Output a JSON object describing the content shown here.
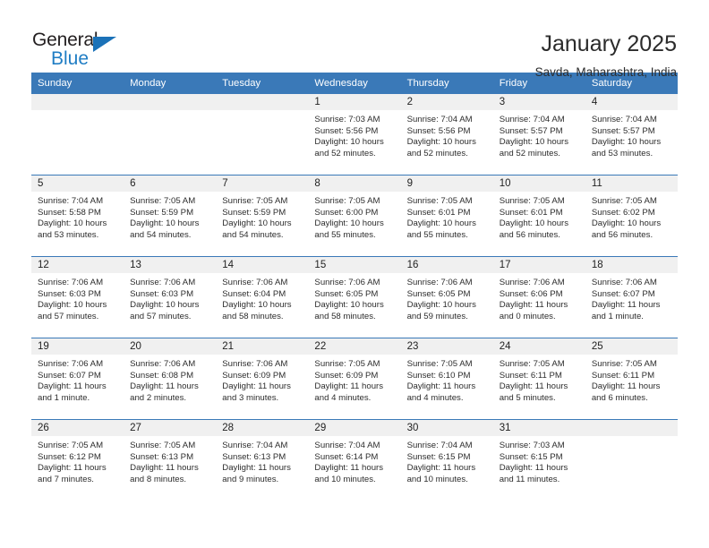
{
  "logo": {
    "word1": "General",
    "word2": "Blue",
    "triangle_color": "#1b72b8",
    "blue_color": "#1f7dc4"
  },
  "header": {
    "title": "January 2025",
    "subtitle": "Savda, Maharashtra, India"
  },
  "calendar": {
    "header_bg": "#3a79b8",
    "daynum_bg": "#f0f0f0",
    "weekdays": [
      "Sunday",
      "Monday",
      "Tuesday",
      "Wednesday",
      "Thursday",
      "Friday",
      "Saturday"
    ],
    "weeks": [
      [
        {
          "day": "",
          "lines": []
        },
        {
          "day": "",
          "lines": []
        },
        {
          "day": "",
          "lines": []
        },
        {
          "day": "1",
          "lines": [
            "Sunrise: 7:03 AM",
            "Sunset: 5:56 PM",
            "Daylight: 10 hours",
            "and 52 minutes."
          ]
        },
        {
          "day": "2",
          "lines": [
            "Sunrise: 7:04 AM",
            "Sunset: 5:56 PM",
            "Daylight: 10 hours",
            "and 52 minutes."
          ]
        },
        {
          "day": "3",
          "lines": [
            "Sunrise: 7:04 AM",
            "Sunset: 5:57 PM",
            "Daylight: 10 hours",
            "and 52 minutes."
          ]
        },
        {
          "day": "4",
          "lines": [
            "Sunrise: 7:04 AM",
            "Sunset: 5:57 PM",
            "Daylight: 10 hours",
            "and 53 minutes."
          ]
        }
      ],
      [
        {
          "day": "5",
          "lines": [
            "Sunrise: 7:04 AM",
            "Sunset: 5:58 PM",
            "Daylight: 10 hours",
            "and 53 minutes."
          ]
        },
        {
          "day": "6",
          "lines": [
            "Sunrise: 7:05 AM",
            "Sunset: 5:59 PM",
            "Daylight: 10 hours",
            "and 54 minutes."
          ]
        },
        {
          "day": "7",
          "lines": [
            "Sunrise: 7:05 AM",
            "Sunset: 5:59 PM",
            "Daylight: 10 hours",
            "and 54 minutes."
          ]
        },
        {
          "day": "8",
          "lines": [
            "Sunrise: 7:05 AM",
            "Sunset: 6:00 PM",
            "Daylight: 10 hours",
            "and 55 minutes."
          ]
        },
        {
          "day": "9",
          "lines": [
            "Sunrise: 7:05 AM",
            "Sunset: 6:01 PM",
            "Daylight: 10 hours",
            "and 55 minutes."
          ]
        },
        {
          "day": "10",
          "lines": [
            "Sunrise: 7:05 AM",
            "Sunset: 6:01 PM",
            "Daylight: 10 hours",
            "and 56 minutes."
          ]
        },
        {
          "day": "11",
          "lines": [
            "Sunrise: 7:05 AM",
            "Sunset: 6:02 PM",
            "Daylight: 10 hours",
            "and 56 minutes."
          ]
        }
      ],
      [
        {
          "day": "12",
          "lines": [
            "Sunrise: 7:06 AM",
            "Sunset: 6:03 PM",
            "Daylight: 10 hours",
            "and 57 minutes."
          ]
        },
        {
          "day": "13",
          "lines": [
            "Sunrise: 7:06 AM",
            "Sunset: 6:03 PM",
            "Daylight: 10 hours",
            "and 57 minutes."
          ]
        },
        {
          "day": "14",
          "lines": [
            "Sunrise: 7:06 AM",
            "Sunset: 6:04 PM",
            "Daylight: 10 hours",
            "and 58 minutes."
          ]
        },
        {
          "day": "15",
          "lines": [
            "Sunrise: 7:06 AM",
            "Sunset: 6:05 PM",
            "Daylight: 10 hours",
            "and 58 minutes."
          ]
        },
        {
          "day": "16",
          "lines": [
            "Sunrise: 7:06 AM",
            "Sunset: 6:05 PM",
            "Daylight: 10 hours",
            "and 59 minutes."
          ]
        },
        {
          "day": "17",
          "lines": [
            "Sunrise: 7:06 AM",
            "Sunset: 6:06 PM",
            "Daylight: 11 hours",
            "and 0 minutes."
          ]
        },
        {
          "day": "18",
          "lines": [
            "Sunrise: 7:06 AM",
            "Sunset: 6:07 PM",
            "Daylight: 11 hours",
            "and 1 minute."
          ]
        }
      ],
      [
        {
          "day": "19",
          "lines": [
            "Sunrise: 7:06 AM",
            "Sunset: 6:07 PM",
            "Daylight: 11 hours",
            "and 1 minute."
          ]
        },
        {
          "day": "20",
          "lines": [
            "Sunrise: 7:06 AM",
            "Sunset: 6:08 PM",
            "Daylight: 11 hours",
            "and 2 minutes."
          ]
        },
        {
          "day": "21",
          "lines": [
            "Sunrise: 7:06 AM",
            "Sunset: 6:09 PM",
            "Daylight: 11 hours",
            "and 3 minutes."
          ]
        },
        {
          "day": "22",
          "lines": [
            "Sunrise: 7:05 AM",
            "Sunset: 6:09 PM",
            "Daylight: 11 hours",
            "and 4 minutes."
          ]
        },
        {
          "day": "23",
          "lines": [
            "Sunrise: 7:05 AM",
            "Sunset: 6:10 PM",
            "Daylight: 11 hours",
            "and 4 minutes."
          ]
        },
        {
          "day": "24",
          "lines": [
            "Sunrise: 7:05 AM",
            "Sunset: 6:11 PM",
            "Daylight: 11 hours",
            "and 5 minutes."
          ]
        },
        {
          "day": "25",
          "lines": [
            "Sunrise: 7:05 AM",
            "Sunset: 6:11 PM",
            "Daylight: 11 hours",
            "and 6 minutes."
          ]
        }
      ],
      [
        {
          "day": "26",
          "lines": [
            "Sunrise: 7:05 AM",
            "Sunset: 6:12 PM",
            "Daylight: 11 hours",
            "and 7 minutes."
          ]
        },
        {
          "day": "27",
          "lines": [
            "Sunrise: 7:05 AM",
            "Sunset: 6:13 PM",
            "Daylight: 11 hours",
            "and 8 minutes."
          ]
        },
        {
          "day": "28",
          "lines": [
            "Sunrise: 7:04 AM",
            "Sunset: 6:13 PM",
            "Daylight: 11 hours",
            "and 9 minutes."
          ]
        },
        {
          "day": "29",
          "lines": [
            "Sunrise: 7:04 AM",
            "Sunset: 6:14 PM",
            "Daylight: 11 hours",
            "and 10 minutes."
          ]
        },
        {
          "day": "30",
          "lines": [
            "Sunrise: 7:04 AM",
            "Sunset: 6:15 PM",
            "Daylight: 11 hours",
            "and 10 minutes."
          ]
        },
        {
          "day": "31",
          "lines": [
            "Sunrise: 7:03 AM",
            "Sunset: 6:15 PM",
            "Daylight: 11 hours",
            "and 11 minutes."
          ]
        },
        {
          "day": "",
          "lines": []
        }
      ]
    ]
  }
}
